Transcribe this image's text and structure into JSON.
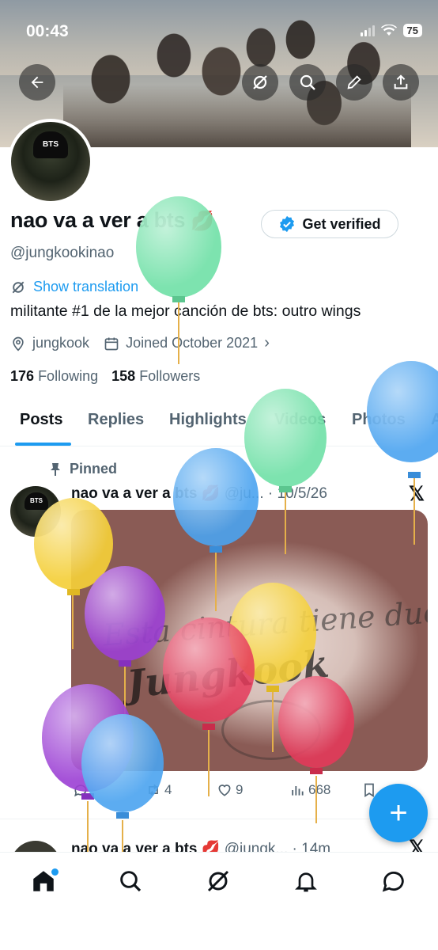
{
  "status_bar": {
    "time": "00:43",
    "battery": "75"
  },
  "profile": {
    "name": "nao va a ver a bts",
    "name_emoji": "💋",
    "get_verified": "Get verified",
    "handle": "@jungkookinao",
    "show_translation": "Show translation",
    "bio": "militante #1 de la mejor canción de bts: outro wings",
    "location": "jungkook",
    "joined": "Joined October 2021",
    "following_count": "176",
    "following_label": "Following",
    "followers_count": "158",
    "followers_label": "Followers",
    "avatar_cap_text": "BTS"
  },
  "tabs": [
    "Posts",
    "Replies",
    "Highlights",
    "Videos",
    "Photos",
    "A"
  ],
  "post": {
    "pinned_label": "Pinned",
    "author": "nao va a ver a bts",
    "emoji": "💋",
    "handle": "@ju...",
    "date": "· 10/5/26",
    "media_text_1": "Esta cintura tiene dueño",
    "media_text_2": "Jungkook",
    "retweets": "4",
    "likes": "9",
    "views": "668"
  },
  "post2": {
    "author": "nao va a ver a bts",
    "emoji": "💋",
    "handle": "@jungk...",
    "time": "· 14m"
  },
  "fab_label": "+",
  "icons": {
    "back": "arrow-left-icon",
    "grok": "grok-icon",
    "search": "search-icon",
    "edit": "pencil-icon",
    "share": "share-icon",
    "home": "home-icon",
    "notifications": "bell-icon",
    "messages": "chat-icon"
  },
  "colors": {
    "accent": "#1d9bf0",
    "balloon_green": "#6fe0a6",
    "balloon_blue": "#4aa3f0",
    "balloon_yellow": "#f4cf3a",
    "balloon_purple": "#9b3fd4",
    "balloon_red": "#e5395a"
  }
}
